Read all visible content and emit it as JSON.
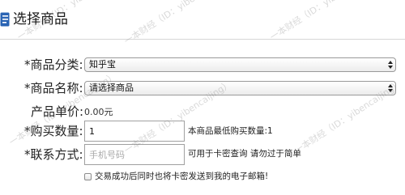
{
  "header": {
    "title": "选择商品",
    "icon": "document-icon",
    "accent": "#2a64b4"
  },
  "form": {
    "category": {
      "label": "*商品分类:",
      "value": "知乎宝"
    },
    "product": {
      "label": "*商品名称:",
      "value": "请选择商品"
    },
    "price": {
      "label": "产品单价:",
      "value": "0.00元"
    },
    "quantity": {
      "label": "*购买数量:",
      "value": "1",
      "hint": "本商品最低购买数量:1"
    },
    "contact": {
      "label": "*联系方式:",
      "placeholder": "手机号码",
      "hint": "可用于卡密查询 请勿过于简单"
    },
    "email_option": {
      "label": "交易成功后同时也将卡密发送到我的电子邮箱!",
      "checked": false
    }
  },
  "watermark": {
    "text": "一本财经（ID：yibencaijing）"
  }
}
